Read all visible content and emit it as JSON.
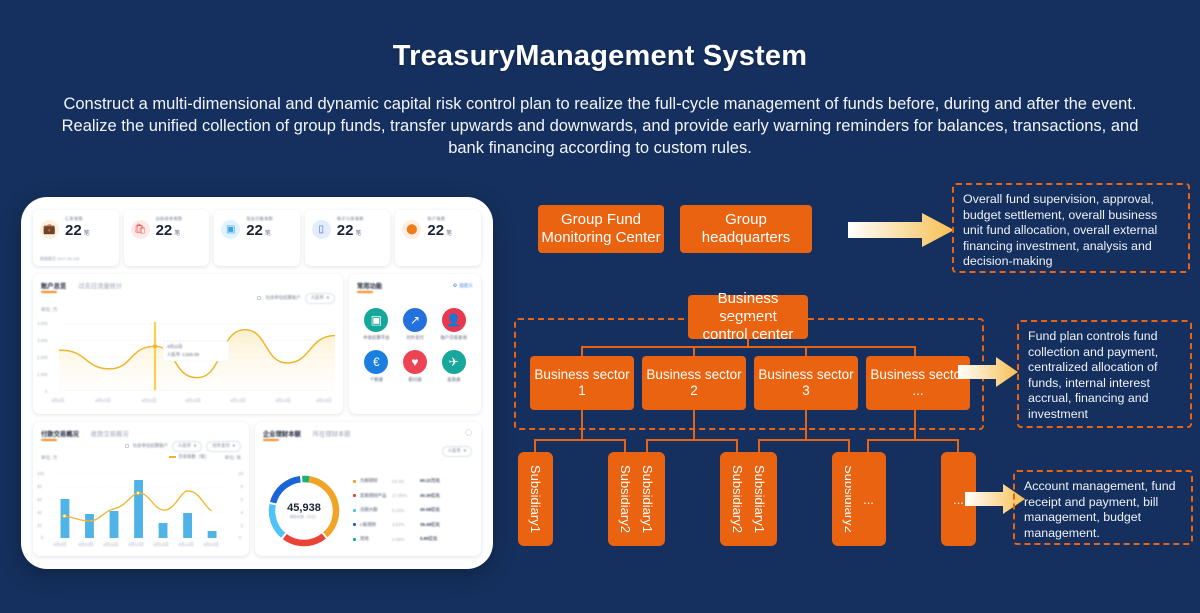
{
  "header": {
    "title": "TreasuryManagement System",
    "description": "Construct a multi-dimensional and dynamic capital risk control plan to realize the full-cycle management of funds before, during and after the event. Realize the unified collection of group funds, transfer upwards and downwards, and provide early warning reminders for balances, transactions, and bank financing according to custom rules."
  },
  "colors": {
    "background": "#15305e",
    "accent_orange": "#ea6310",
    "arrow_gold": "#f5bc52",
    "chart_yellow": "#f0b429",
    "chart_blue": "#4fb3e8"
  },
  "dashboard": {
    "kpis": [
      {
        "icon": "briefcase-icon",
        "label": "汇款笔数",
        "value": "22",
        "unit": "笔",
        "sub": "数据截至 2017.06.130",
        "icon_bg": "#fdf0dd",
        "icon_color": "#f0a026"
      },
      {
        "icon": "bag-icon",
        "label": "自助收单笔数",
        "value": "22",
        "unit": "笔",
        "sub": "",
        "icon_bg": "#fde9e7",
        "icon_color": "#ec4f45"
      },
      {
        "icon": "layers-icon",
        "label": "现金归集笔数",
        "value": "22",
        "unit": "笔",
        "sub": "",
        "icon_bg": "#e0f2fe",
        "icon_color": "#38a2ea"
      },
      {
        "icon": "card-icon",
        "label": "电子公章笔数",
        "value": "22",
        "unit": "笔",
        "sub": "",
        "icon_bg": "#e4ecfd",
        "icon_color": "#3a6fe0"
      },
      {
        "icon": "coins-icon",
        "label": "账户笔数",
        "value": "22",
        "unit": "笔",
        "sub": "",
        "icon_bg": "#fdeee0",
        "icon_color": "#f07c1e"
      }
    ],
    "line_panel": {
      "tab_active": "账户总览",
      "tab_idle": "过去日流量统计",
      "checkbox_label": "包含单位结算账户",
      "currency_select": "人民币",
      "unit": "单位: 万",
      "tooltip_title": "4月11日",
      "tooltip_value": "人民币: 2,926.09"
    },
    "apps_panel": {
      "title": "常用功能",
      "custom_label": "自定义",
      "apps": [
        {
          "name": "中金结算平台",
          "color": "#16a79a",
          "glyph": "▤"
        },
        {
          "name": "对外支付",
          "color": "#2470dd",
          "glyph": "↗"
        },
        {
          "name": "账户交易查询",
          "color": "#e8384f",
          "glyph": "●"
        },
        {
          "name": "个税通",
          "color": "#1b7fe0",
          "glyph": "€"
        },
        {
          "name": "薪问通",
          "color": "#ec4455",
          "glyph": "♥"
        },
        {
          "name": "差旅通",
          "color": "#17a79b",
          "glyph": "✈"
        }
      ]
    },
    "bar_panel": {
      "tab_active": "付款交易概况",
      "tab_idle": "收款交易概况",
      "checkbox_label": "包含单位结算账户",
      "currency_select": "人民币",
      "type_select": "对外支付",
      "unit_left": "单位: 万",
      "unit_right": "单位: 笔",
      "legend_line": "交易笔数（笔）"
    },
    "donut_panel": {
      "tab_active": "企业理财本额",
      "tab_idle": "所在理财本额",
      "currency_select": "人民币",
      "center_value": "45,938",
      "center_sub": "理财本额（万元）",
      "legend": [
        {
          "name": "为期理财",
          "pct": "63.3%",
          "amount": "60.22万元",
          "color": "#f0a529"
        },
        {
          "name": "定期理财产品",
          "pct": "17.55%",
          "amount": "40.30亿元",
          "color": "#ea4335"
        },
        {
          "name": "活期大额",
          "pct": "6.23%",
          "amount": "40.08亿元",
          "color": "#4fc3f7"
        },
        {
          "name": "t-账理财",
          "pct": "4.52%",
          "amount": "39.49亿元",
          "color": "#1b64d8"
        },
        {
          "name": "其他",
          "pct": "2.08%",
          "amount": "5.85亿元",
          "color": "#16b378"
        }
      ]
    }
  },
  "chart_data": [
    {
      "type": "line",
      "title": "账户总览",
      "xlabel": "",
      "ylabel": "单位: 万",
      "categories": [
        "4月9日",
        "4月10日",
        "4月11日",
        "4月12日",
        "4月13日",
        "4月14日",
        "4月15日"
      ],
      "ytick_labels": [
        "4,000",
        "3,000",
        "2,000",
        "1,000",
        "0"
      ],
      "ylim": [
        0,
        4400
      ],
      "values": [
        2400,
        2050,
        2600,
        1620,
        3750,
        2250,
        3450
      ],
      "grid": true,
      "legend_position": "none"
    },
    {
      "type": "bar",
      "title": "付款交易概况",
      "xlabel": "",
      "ylabel": "单位: 万",
      "categories": [
        "4月9日",
        "4月10日",
        "4月11日",
        "4月12日",
        "4月13日",
        "4月14日",
        "4月15日"
      ],
      "ytick_labels_left": [
        "100",
        "80",
        "60",
        "40",
        "20",
        "0"
      ],
      "ytick_labels_right": [
        "10",
        "8",
        "6",
        "4",
        "2",
        "0"
      ],
      "ylim": [
        0,
        100
      ],
      "series": [
        {
          "name": "付款金额（万）",
          "type": "bar",
          "values": [
            60,
            35,
            41,
            90,
            20,
            38,
            10
          ]
        },
        {
          "name": "交易笔数（笔）",
          "type": "line",
          "values": [
            4.2,
            3.2,
            4.6,
            6.3,
            5.0,
            6.9,
            4.3
          ]
        }
      ],
      "grid": true,
      "legend_position": "top-right"
    },
    {
      "type": "pie",
      "title": "企业理财本额",
      "center_value": "45,938",
      "labels": [
        "为期理财",
        "定期理财产品",
        "活期大额",
        "t-账理财",
        "其他"
      ],
      "values": [
        63.3,
        17.55,
        6.23,
        4.52,
        2.08
      ],
      "colors": [
        "#f0a529",
        "#ea4335",
        "#4fc3f7",
        "#1b64d8",
        "#16b378"
      ],
      "legend_position": "right"
    }
  ],
  "diagram": {
    "top_boxes": [
      {
        "label": "Group Fund\nMonitoring Center"
      },
      {
        "label": "Group\nheadquarters"
      }
    ],
    "segment_center": {
      "label": "Business segment\ncontrol center"
    },
    "sectors": [
      {
        "label": "Business sector\n1"
      },
      {
        "label": "Business sector\n2"
      },
      {
        "label": "Business sector\n3"
      },
      {
        "label": "Business sector\n..."
      }
    ],
    "subsidiaries": [
      "Subsidiary1",
      "Subsidiary2",
      "Subsidiary1",
      "Subsidiary2",
      "Subsidiary1",
      "Subsidiary2",
      "...",
      "..."
    ],
    "notes": [
      {
        "text": "Overall fund supervision, approval, budget settlement, overall business unit fund allocation, overall external financing investment, analysis and decision-making"
      },
      {
        "text": "Fund plan controls fund collection and payment, centralized allocation of funds, internal interest accrual, financing and investment"
      },
      {
        "text": "Account management, fund receipt and payment, bill management, budget management."
      }
    ]
  }
}
